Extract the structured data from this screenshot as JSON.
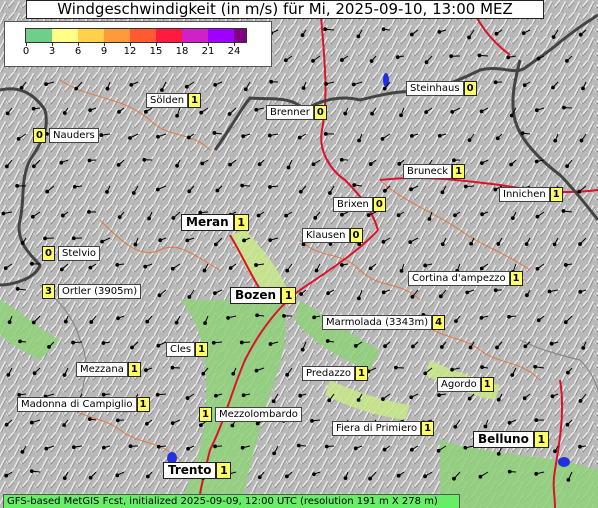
{
  "title": "Windgeschwindigkeit (in m/s) für Mi, 2025-09-10, 13:00 MEZ",
  "legend": {
    "ticks": [
      "0",
      "3",
      "6",
      "9",
      "12",
      "15",
      "18",
      "21",
      "24"
    ],
    "colors": [
      "#6fcf8a",
      "#ffff88",
      "#ffd24a",
      "#ff9a3a",
      "#ff5a30",
      "#ff1a40",
      "#d020c8",
      "#a000ff",
      "#800080"
    ]
  },
  "stations": [
    {
      "name": "Sölden",
      "value": "1",
      "label_first": true,
      "big": false
    },
    {
      "name": "Steinhaus",
      "value": "0",
      "label_first": true,
      "big": false
    },
    {
      "name": "Brenner",
      "value": "0",
      "label_first": true,
      "big": false
    },
    {
      "name": "Nauders",
      "value": "0",
      "label_first": false,
      "big": false
    },
    {
      "name": "Bruneck",
      "value": "1",
      "label_first": true,
      "big": false
    },
    {
      "name": "Innichen",
      "value": "1",
      "label_first": true,
      "big": false
    },
    {
      "name": "Brixen",
      "value": "0",
      "label_first": true,
      "big": false
    },
    {
      "name": "Meran",
      "value": "1",
      "label_first": true,
      "big": true
    },
    {
      "name": "Klausen",
      "value": "0",
      "label_first": true,
      "big": false
    },
    {
      "name": "Stelvio",
      "value": "0",
      "label_first": false,
      "big": false
    },
    {
      "name": "Cortina d'ampezzo",
      "value": "1",
      "label_first": true,
      "big": false
    },
    {
      "name": "Ortler (3905m)",
      "value": "3",
      "label_first": false,
      "big": false
    },
    {
      "name": "Bozen",
      "value": "1",
      "label_first": true,
      "big": true
    },
    {
      "name": "Marmolada (3343m)",
      "value": "4",
      "label_first": true,
      "big": false
    },
    {
      "name": "Cles",
      "value": "1",
      "label_first": true,
      "big": false
    },
    {
      "name": "Mezzana",
      "value": "1",
      "label_first": true,
      "big": false
    },
    {
      "name": "Predazzo",
      "value": "1",
      "label_first": true,
      "big": false
    },
    {
      "name": "Agordo",
      "value": "1",
      "label_first": true,
      "big": false
    },
    {
      "name": "Madonna di Campiglio",
      "value": "1",
      "label_first": true,
      "big": false
    },
    {
      "name": "Mezzolombardo",
      "value": "1",
      "label_first": false,
      "big": false
    },
    {
      "name": "Fiera di Primiero",
      "value": "1",
      "label_first": true,
      "big": false
    },
    {
      "name": "Belluno",
      "value": "1",
      "label_first": true,
      "big": true
    },
    {
      "name": "Trento",
      "value": "1",
      "label_first": true,
      "big": true
    }
  ],
  "footer": "GFS-based MetGIS Fcst, initialized 2025-09-09, 12:00 UTC  (resolution 191 m X 278 m)"
}
